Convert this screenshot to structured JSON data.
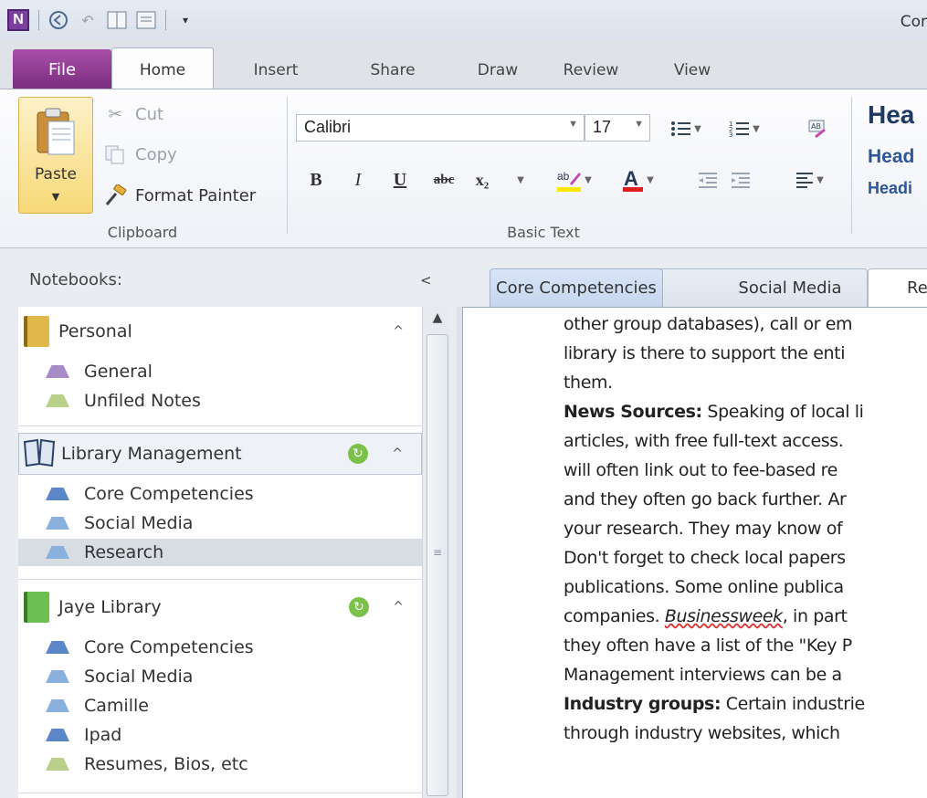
{
  "window": {
    "title": "Cor"
  },
  "ribbon_tabs": [
    "File",
    "Home",
    "Insert",
    "Share",
    "Draw",
    "Review",
    "View"
  ],
  "clipboard": {
    "paste_label": "Paste",
    "cut_label": "Cut",
    "copy_label": "Copy",
    "format_painter_label": "Format Painter",
    "group_label": "Clipboard"
  },
  "basic_text": {
    "font_name": "Calibri",
    "font_size": "17",
    "bold": "B",
    "italic": "I",
    "underline": "U",
    "strike": "abc",
    "subscript": "x₂",
    "group_label": "Basic Text"
  },
  "styles": {
    "heading1": "Hea",
    "heading2": "Head",
    "heading3": "Headi"
  },
  "nav": {
    "header": "Notebooks:",
    "notebooks": [
      {
        "name": "Personal",
        "color": "#e0b84a",
        "sections": [
          {
            "name": "General",
            "color": "#a78bc7"
          },
          {
            "name": "Unfiled Notes",
            "color": "#b8d08a"
          }
        ]
      },
      {
        "name": "Library Management",
        "color": "#4b6b95",
        "sections": [
          {
            "name": "Core Competencies",
            "color": "#5b86c8"
          },
          {
            "name": "Social Media",
            "color": "#8ab0dd"
          },
          {
            "name": "Research",
            "color": "#8ab0dd"
          }
        ]
      },
      {
        "name": "Jaye Library",
        "color": "#6cbf52",
        "sections": [
          {
            "name": "Core Competencies",
            "color": "#5b86c8"
          },
          {
            "name": "Social Media",
            "color": "#8ab0dd"
          },
          {
            "name": "Camille",
            "color": "#8ab0dd"
          },
          {
            "name": "Ipad",
            "color": "#5b86c8"
          },
          {
            "name": "Resumes, Bios, etc",
            "color": "#b8d08a"
          }
        ]
      }
    ]
  },
  "page_tabs": [
    "Core Competencies",
    "Social Media",
    "Re"
  ],
  "page_text": {
    "l1": "other group databases), call or em",
    "l2": "library is there to support the enti",
    "l3": "them.",
    "l4_bold": "News Sources:",
    "l4_rest": " Speaking of local li",
    "l5": "articles, with free full-text access.",
    "l6": "will often link out to fee-based re",
    "l7": "and they often go back further. Ar",
    "l8": "your research. They may know of",
    "l9": "Don't forget to check local papers",
    "l10": "publications. Some online publica",
    "l11_a": "companies. ",
    "l11_italic": "Businessweek",
    "l11_b": ", in part",
    "l12": "they often have a list of the \"Key P",
    "l13": "Management interviews can be a",
    "l14_bold": "Industry groups:",
    "l14_rest": " Certain industrie",
    "l15": "through industry websites, which"
  }
}
